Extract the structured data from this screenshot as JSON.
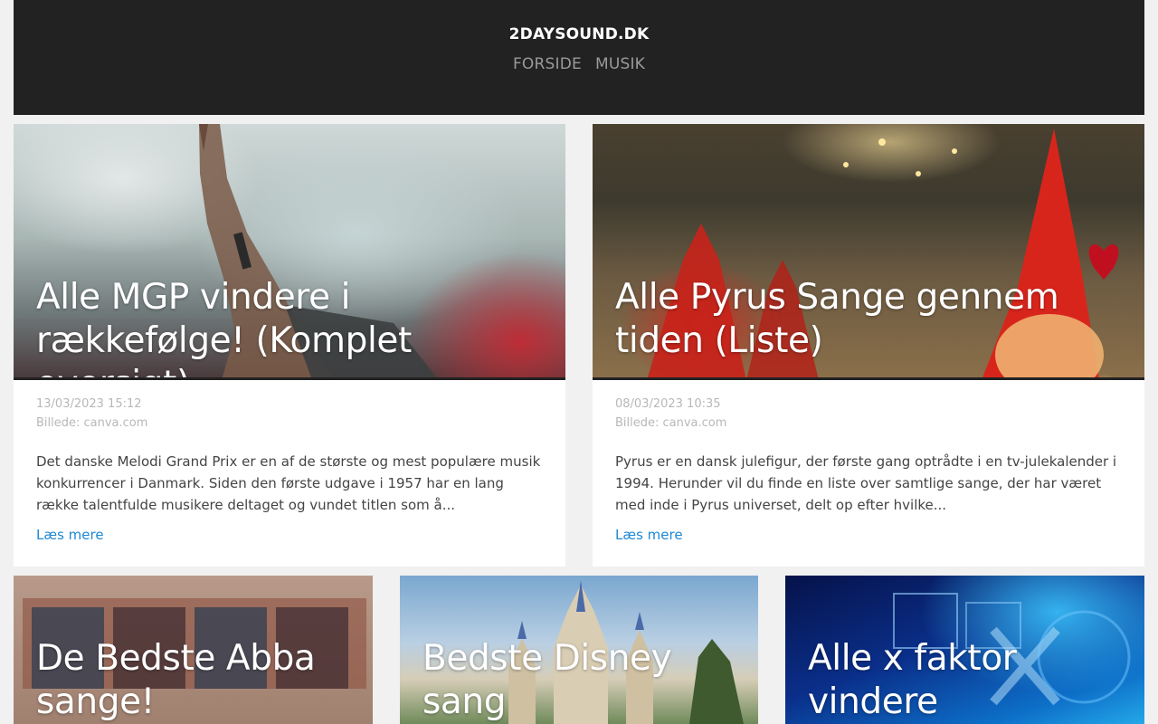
{
  "header": {
    "site_title": "2DAYSOUND.DK",
    "nav": [
      {
        "label": "FORSIDE"
      },
      {
        "label": "MUSIK"
      }
    ]
  },
  "featured": [
    {
      "title": "Alle MGP vindere i rækkefølge! (Komplet oversigt)",
      "date": "13/03/2023 15:12",
      "image_credit": "Billede: canva.com",
      "excerpt": "Det danske Melodi Grand Prix er en af de største og mest populære musik konkurrencer i Danmark. Siden den første udgave i 1957 har en lang række talentfulde musikere deltaget og vundet titlen som å...",
      "read_more": "Læs mere"
    },
    {
      "title": "Alle Pyrus Sange gennem tiden (Liste)",
      "date": "08/03/2023 10:35",
      "image_credit": "Billede: canva.com",
      "excerpt": "Pyrus er en dansk julefigur, der første gang optrådte i en tv-julekalender i 1994. Herunder vil du finde en liste over samtlige sange, der har været med inde i Pyrus universet, delt op efter hvilke...",
      "read_more": "Læs mere"
    }
  ],
  "secondary": [
    {
      "title": "De Bedste Abba sange!"
    },
    {
      "title": "Bedste Disney sang"
    },
    {
      "title": "Alle x faktor vindere"
    }
  ],
  "colors": {
    "header_bg": "#222222",
    "page_bg": "#f1f1f1",
    "link": "#1e88d6"
  }
}
